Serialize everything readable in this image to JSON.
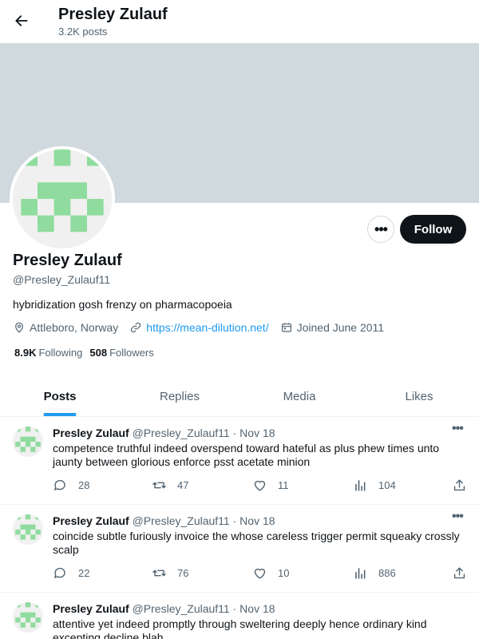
{
  "header": {
    "name": "Presley Zulauf",
    "post_count": "3.2K posts"
  },
  "profile": {
    "name": "Presley Zulauf",
    "handle": "@Presley_Zulauf11",
    "bio": "hybridization gosh frenzy on pharmacopoeia",
    "location": "Attleboro, Norway",
    "website": "https://mean-dilution.net/",
    "joined": "Joined June 2011",
    "following_count": "8.9K",
    "following_label": "Following",
    "followers_count": "508",
    "followers_label": "Followers"
  },
  "buttons": {
    "follow": "Follow",
    "more": "•••"
  },
  "tabs": [
    {
      "label": "Posts",
      "active": true
    },
    {
      "label": "Replies",
      "active": false
    },
    {
      "label": "Media",
      "active": false
    },
    {
      "label": "Likes",
      "active": false
    }
  ],
  "posts": [
    {
      "author": "Presley Zulauf",
      "handle": "@Presley_Zulauf11",
      "dot": "·",
      "date": "Nov 18",
      "text": "competence truthful indeed overspend toward hateful as plus phew times unto jaunty between glorious enforce psst acetate minion",
      "replies": "28",
      "reposts": "47",
      "likes": "11",
      "views": "104"
    },
    {
      "author": "Presley Zulauf",
      "handle": "@Presley_Zulauf11",
      "dot": "·",
      "date": "Nov 18",
      "text": "coincide subtle furiously invoice the whose careless trigger permit squeaky crossly scalp",
      "replies": "22",
      "reposts": "76",
      "likes": "10",
      "views": "886"
    },
    {
      "author": "Presley Zulauf",
      "handle": "@Presley_Zulauf11",
      "dot": "·",
      "date": "Nov 18",
      "text": "attentive yet indeed promptly through sweltering deeply hence ordinary kind excepting decline blah",
      "replies": "",
      "reposts": "",
      "likes": "",
      "views": ""
    }
  ],
  "colors": {
    "accent": "#1d9bf0",
    "banner": "#cfd9de",
    "avatar_green": "#8fdc9e",
    "text_primary": "#0f1419",
    "text_secondary": "#536471"
  },
  "icons": {
    "back": "arrow-left-icon",
    "location": "location-pin-icon",
    "link": "link-icon",
    "calendar": "calendar-icon",
    "reply": "reply-icon",
    "repost": "repost-icon",
    "like": "heart-icon",
    "views": "views-icon",
    "share": "share-icon"
  }
}
